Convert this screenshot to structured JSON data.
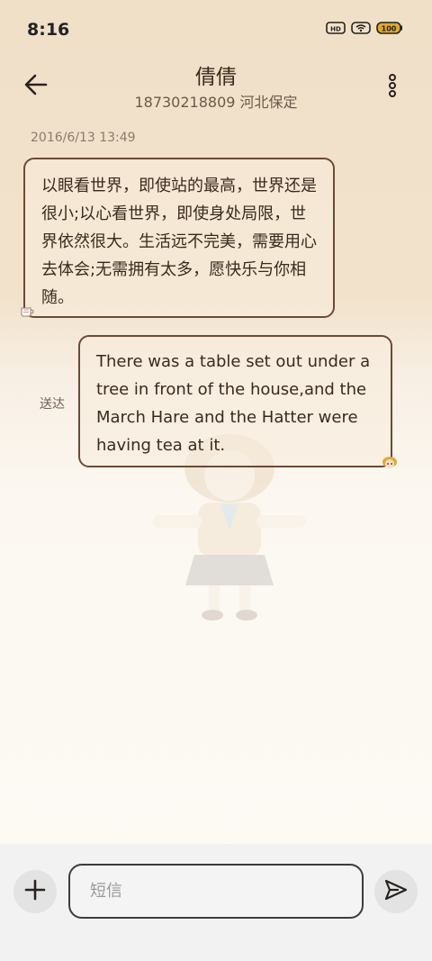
{
  "status_bar": {
    "time": "8:16",
    "icons": [
      "hd-signal-icon",
      "wifi-icon",
      "battery-icon"
    ]
  },
  "header": {
    "contact_name": "倩倩",
    "contact_detail": "18730218809 河北保定",
    "back_icon": "arrow-left-icon",
    "menu_icon": "more-vertical-icon"
  },
  "conversation": {
    "timestamp": "2016/6/13 13:49",
    "messages": [
      {
        "direction": "incoming",
        "text": "以眼看世界，即使站的最高，世界还是很小;以心看世界，即使身处局限，世界依然很大。生活远不完美，需要用心去体会;无需拥有太多，愿快乐与你相随。"
      },
      {
        "direction": "outgoing",
        "text": "There was a table set out under a tree in front of the house,and the March Hare and the Hatter were having tea at it.",
        "status": "送达"
      }
    ]
  },
  "composer": {
    "placeholder": "短信",
    "value": "",
    "add_icon": "plus-icon",
    "send_icon": "send-icon"
  },
  "colors": {
    "bubble_border": "#6b4a36",
    "background_top": "#f1e0c8",
    "background_bottom": "#fdfaf5",
    "bottom_bar": "#f2f2f2"
  }
}
